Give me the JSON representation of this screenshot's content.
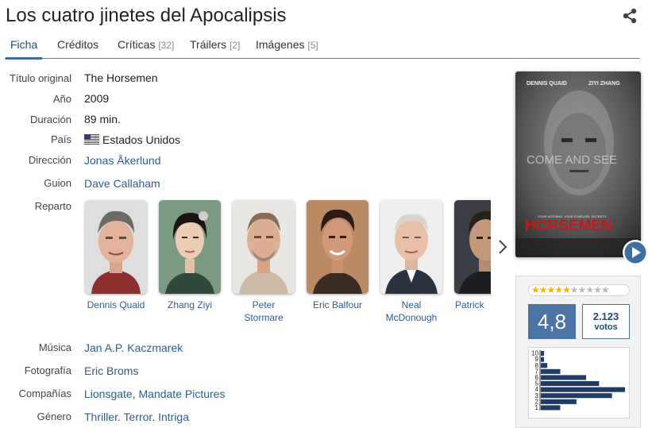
{
  "title": "Los cuatro jinetes del Apocalipsis",
  "tabs": [
    {
      "label": "Ficha",
      "count": ""
    },
    {
      "label": "Créditos",
      "count": ""
    },
    {
      "label": "Críticas",
      "count": "[32]"
    },
    {
      "label": "Tráilers",
      "count": "[2]"
    },
    {
      "label": "Imágenes",
      "count": "[5]"
    }
  ],
  "details": {
    "original_title_label": "Título original",
    "original_title": "The Horsemen",
    "year_label": "Año",
    "year": "2009",
    "duration_label": "Duración",
    "duration": "89 min.",
    "country_label": "País",
    "country": "Estados Unidos",
    "director_label": "Dirección",
    "director": "Jonas Åkerlund",
    "writer_label": "Guion",
    "writer": "Dave Callaham",
    "cast_label": "Reparto",
    "music_label": "Música",
    "music": "Jan A.P. Kaczmarek",
    "photo_label": "Fotografía",
    "photo": "Eric Broms",
    "companies_label": "Compañías",
    "companies": [
      "Lionsgate",
      "Mandate Pictures"
    ],
    "genre_label": "Género",
    "genre": "Thriller. Terror. Intriga"
  },
  "cast": [
    {
      "name": "Dennis Quaid"
    },
    {
      "name": "Zhang Ziyi"
    },
    {
      "name": "Peter Stormare"
    },
    {
      "name": "Eric Balfour"
    },
    {
      "name": "Neal McDonough"
    },
    {
      "name": "Patrick"
    }
  ],
  "poster": {
    "actor_left": "DENNIS QUAID",
    "actor_right": "ZIYI ZHANG",
    "tagline": "COME AND SEE",
    "small_text": "YOUR NOTHING. YOUR FOREVER. SECRETS.",
    "movie_title": "HORSEMEN"
  },
  "rating": {
    "average": "4,8",
    "votes_count": "2.123",
    "votes_label": "votos",
    "stars_filled": 5,
    "stars_total": 10,
    "histogram_labels": [
      "10",
      "9",
      "8",
      "7",
      "6",
      "5",
      "4",
      "3",
      "2",
      "1"
    ],
    "histogram_values": [
      1,
      1,
      2,
      6,
      14,
      18,
      26,
      22,
      11,
      6
    ]
  },
  "colors": {
    "accent": "#4b73a3",
    "link": "#2e5d8e",
    "histogram_bar": "#1f3b66",
    "star": "#f0b400"
  },
  "icons": {
    "share": "share-icon",
    "next": "chevron-right-icon",
    "play": "play-icon",
    "flag": "us-flag-icon"
  }
}
